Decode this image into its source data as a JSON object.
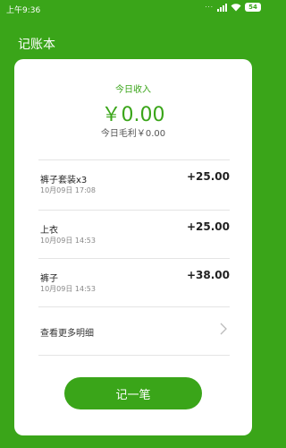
{
  "status_bar": {
    "time": "上午9:36",
    "battery": "54"
  },
  "app": {
    "title": "记账本"
  },
  "summary": {
    "label": "今日收入",
    "amount": "￥0.00",
    "profit": "今日毛利￥0.00"
  },
  "records": [
    {
      "name": "裤子套装x3",
      "date": "10月09日 17:08",
      "amount": "+25.00"
    },
    {
      "name": "上衣",
      "date": "10月09日 14:53",
      "amount": "+25.00"
    },
    {
      "name": "裤子",
      "date": "10月09日 14:53",
      "amount": "+38.00"
    }
  ],
  "more": {
    "label": "查看更多明细"
  },
  "action": {
    "add_label": "记一笔"
  },
  "colors": {
    "accent": "#3aa519",
    "card": "#ffffff"
  }
}
